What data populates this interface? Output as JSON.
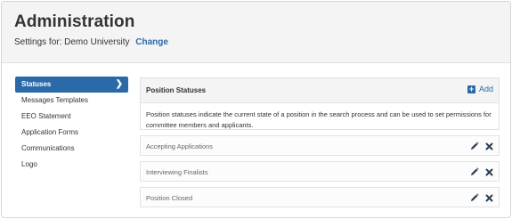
{
  "header": {
    "title": "Administration",
    "settings_prefix": "Settings for:",
    "org_name": "Demo University",
    "change_label": "Change"
  },
  "sidebar": {
    "items": [
      {
        "label": "Statuses",
        "active": true
      },
      {
        "label": "Messages Templates",
        "active": false
      },
      {
        "label": "EEO Statement",
        "active": false
      },
      {
        "label": "Application Forms",
        "active": false
      },
      {
        "label": "Communications",
        "active": false
      },
      {
        "label": "Logo",
        "active": false
      }
    ]
  },
  "main": {
    "panel_title": "Position Statuses",
    "add_label": "Add",
    "description": "Position statuses indicate the current state of a position in the search process and can be used to set permissions for committee members and applicants.",
    "statuses": [
      {
        "name": "Accepting Applications"
      },
      {
        "name": "Interviewing Finalists"
      },
      {
        "name": "Position Closed"
      }
    ]
  },
  "colors": {
    "accent": "#2b6aa8",
    "header_bg": "#f4f4f4",
    "border": "#e2e2e2"
  },
  "icons": {
    "active_chevron": "chevron-right-icon",
    "add": "plus-square-icon",
    "edit": "pencil-icon",
    "delete": "close-icon"
  }
}
